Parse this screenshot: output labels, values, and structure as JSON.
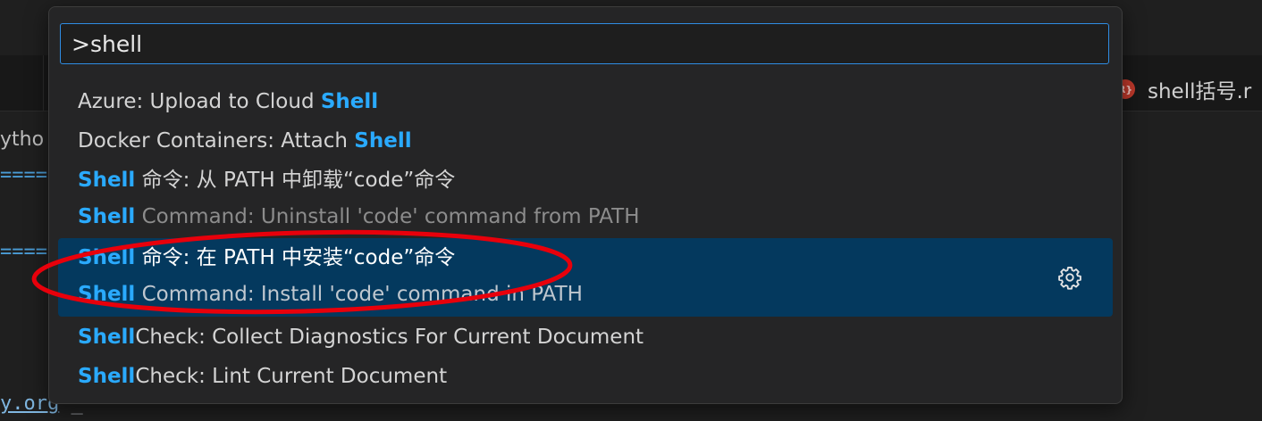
{
  "background": {
    "editor_tab_label": "shell括号.r",
    "crumb": "ytho",
    "eq_line": "=====",
    "link": "y.org",
    "link_suffix": " _"
  },
  "palette": {
    "input_value": ">shell",
    "items": [
      {
        "pre": "Azure: Upload to Cloud ",
        "hl": "Shell",
        "post": ""
      },
      {
        "pre": "Docker Containers: Attach ",
        "hl": "Shell",
        "post": ""
      },
      {
        "hl": "Shell",
        "post": " 命令: 从 PATH 中卸载“code”命令",
        "sub_hl": "Shell",
        "sub_post": " Command: Uninstall 'code' command from PATH"
      },
      {
        "hl": "Shell",
        "post": " 命令: 在 PATH 中安装“code”命令",
        "sub_hl": "Shell",
        "sub_post": " Command: Install 'code' command in PATH",
        "selected": true
      },
      {
        "hl": "Shell",
        "post": "Check: Collect Diagnostics For Current Document"
      },
      {
        "hl": "Shell",
        "post": "Check: Lint Current Document"
      }
    ],
    "gear_icon": "gear-icon"
  },
  "annotation_color": "#e8000b"
}
